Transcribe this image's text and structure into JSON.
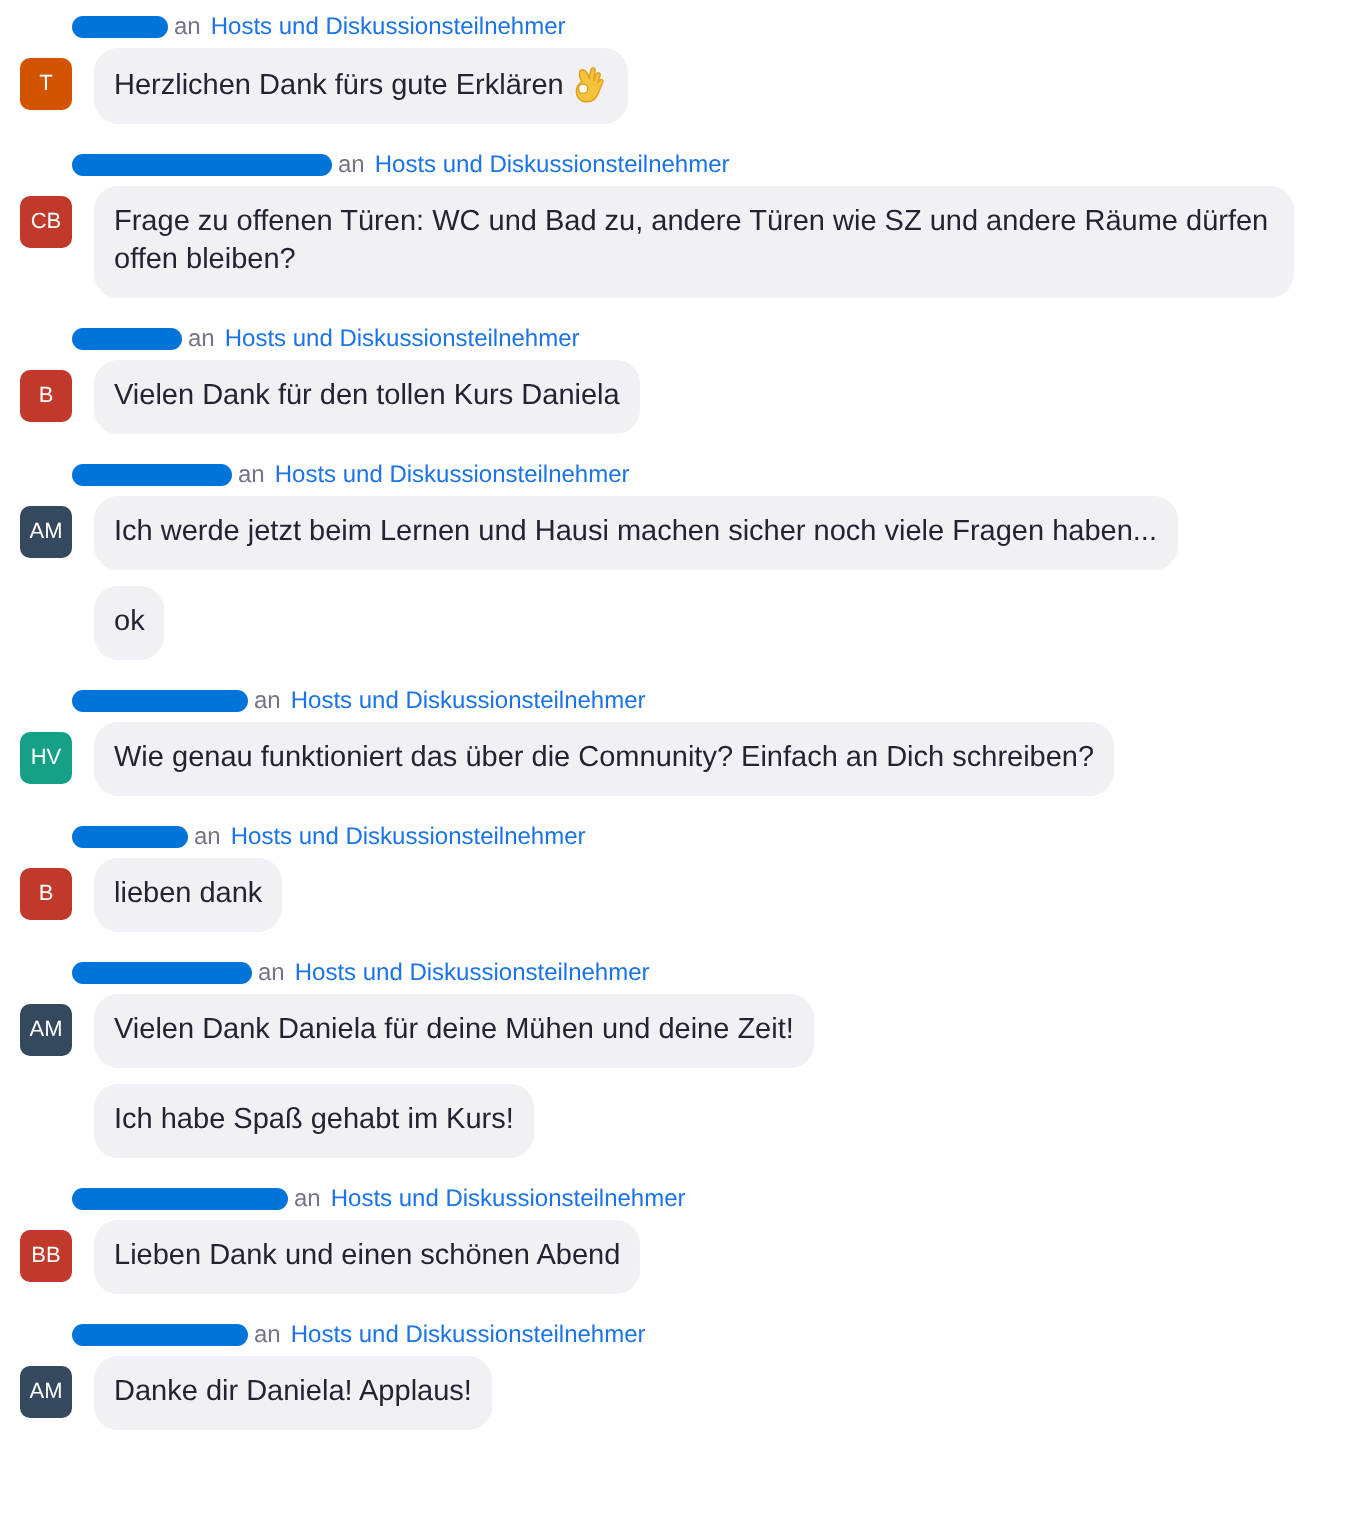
{
  "messages": [
    {
      "avatar": {
        "initials": "T",
        "color": "#d35400"
      },
      "recipient_prefix": "an",
      "recipient": "Hosts und Diskussionsteilnehmer",
      "bubbles": [
        {
          "text": "Herzlichen Dank fürs gute Erklären",
          "kind": "emoji"
        }
      ]
    },
    {
      "avatar": {
        "initials": "CB",
        "color": "#c0392b"
      },
      "recipient_prefix": "an",
      "recipient": "Hosts und Diskussionsteilnehmer",
      "bubbles": [
        {
          "text": "Frage zu offenen Türen: WC und Bad zu, andere Türen wie SZ und andere Räume dürfen offen bleiben?"
        }
      ]
    },
    {
      "avatar": {
        "initials": "B",
        "color": "#c0392b"
      },
      "recipient_prefix": "an",
      "recipient": "Hosts und Diskussionsteilnehmer",
      "bubbles": [
        {
          "text": "Vielen Dank für den tollen Kurs Daniela"
        }
      ]
    },
    {
      "avatar": {
        "initials": "AM",
        "color": "#34495e"
      },
      "recipient_prefix": "an",
      "recipient": "Hosts und Diskussionsteilnehmer",
      "bubbles": [
        {
          "text": "Ich werde jetzt beim Lernen und Hausi machen sicher noch viele Fragen haben..."
        },
        {
          "text": "ok"
        }
      ]
    },
    {
      "avatar": {
        "initials": "HV",
        "color": "#16a085"
      },
      "recipient_prefix": "an",
      "recipient": "Hosts und Diskussionsteilnehmer",
      "bubbles": [
        {
          "text": "Wie genau funktioniert das über die Comnunity? Einfach an Dich schreiben?"
        }
      ]
    },
    {
      "avatar": {
        "initials": "B",
        "color": "#c0392b"
      },
      "recipient_prefix": "an",
      "recipient": "Hosts und Diskussionsteilnehmer",
      "bubbles": [
        {
          "text": "lieben dank"
        }
      ]
    },
    {
      "avatar": {
        "initials": "AM",
        "color": "#34495e"
      },
      "recipient_prefix": "an",
      "recipient": "Hosts und Diskussionsteilnehmer",
      "bubbles": [
        {
          "text": "Vielen Dank Daniela für deine Mühen und deine Zeit!"
        },
        {
          "text": "Ich habe Spaß gehabt im Kurs!"
        }
      ]
    },
    {
      "avatar": {
        "initials": "BB",
        "color": "#c0392b"
      },
      "recipient_prefix": "an",
      "recipient": "Hosts und Diskussionsteilnehmer",
      "bubbles": [
        {
          "text": "Lieben Dank und einen schönen Abend"
        }
      ]
    },
    {
      "avatar": {
        "initials": "AM",
        "color": "#34495e"
      },
      "recipient_prefix": "an",
      "recipient": "Hosts und Diskussionsteilnehmer",
      "bubbles": [
        {
          "text": "Danke dir Daniela! Applaus!"
        }
      ]
    }
  ]
}
